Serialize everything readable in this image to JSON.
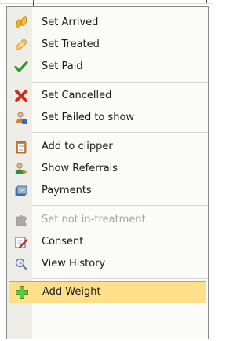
{
  "menu": {
    "items": [
      {
        "label": "Set Arrived",
        "icon": "footprints-icon",
        "state": "normal"
      },
      {
        "label": "Set Treated",
        "icon": "bandage-icon",
        "state": "normal"
      },
      {
        "label": "Set Paid",
        "icon": "checkmark-icon",
        "state": "normal"
      },
      {
        "label": "Set Cancelled",
        "icon": "red-x-icon",
        "state": "normal"
      },
      {
        "label": "Set Failed to show",
        "icon": "person-absent-icon",
        "state": "normal"
      },
      {
        "label": "Add to clipper",
        "icon": "clipboard-icon",
        "state": "normal"
      },
      {
        "label": "Show Referrals",
        "icon": "person-referral-icon",
        "state": "normal"
      },
      {
        "label": "Payments",
        "icon": "payments-icon",
        "state": "normal"
      },
      {
        "label": "Set not in-treatment",
        "icon": "grey-puzzle-icon",
        "state": "disabled"
      },
      {
        "label": "Consent",
        "icon": "consent-pen-icon",
        "state": "normal"
      },
      {
        "label": "View History",
        "icon": "history-magnifier-icon",
        "state": "normal"
      },
      {
        "label": "Add Weight",
        "icon": "green-plus-icon",
        "state": "highlighted"
      }
    ]
  },
  "colors": {
    "highlight_bg": "#fcdf88",
    "highlight_border": "#e0a12e",
    "disabled_text": "#a7a7a7",
    "gutter": "#eeede8"
  }
}
